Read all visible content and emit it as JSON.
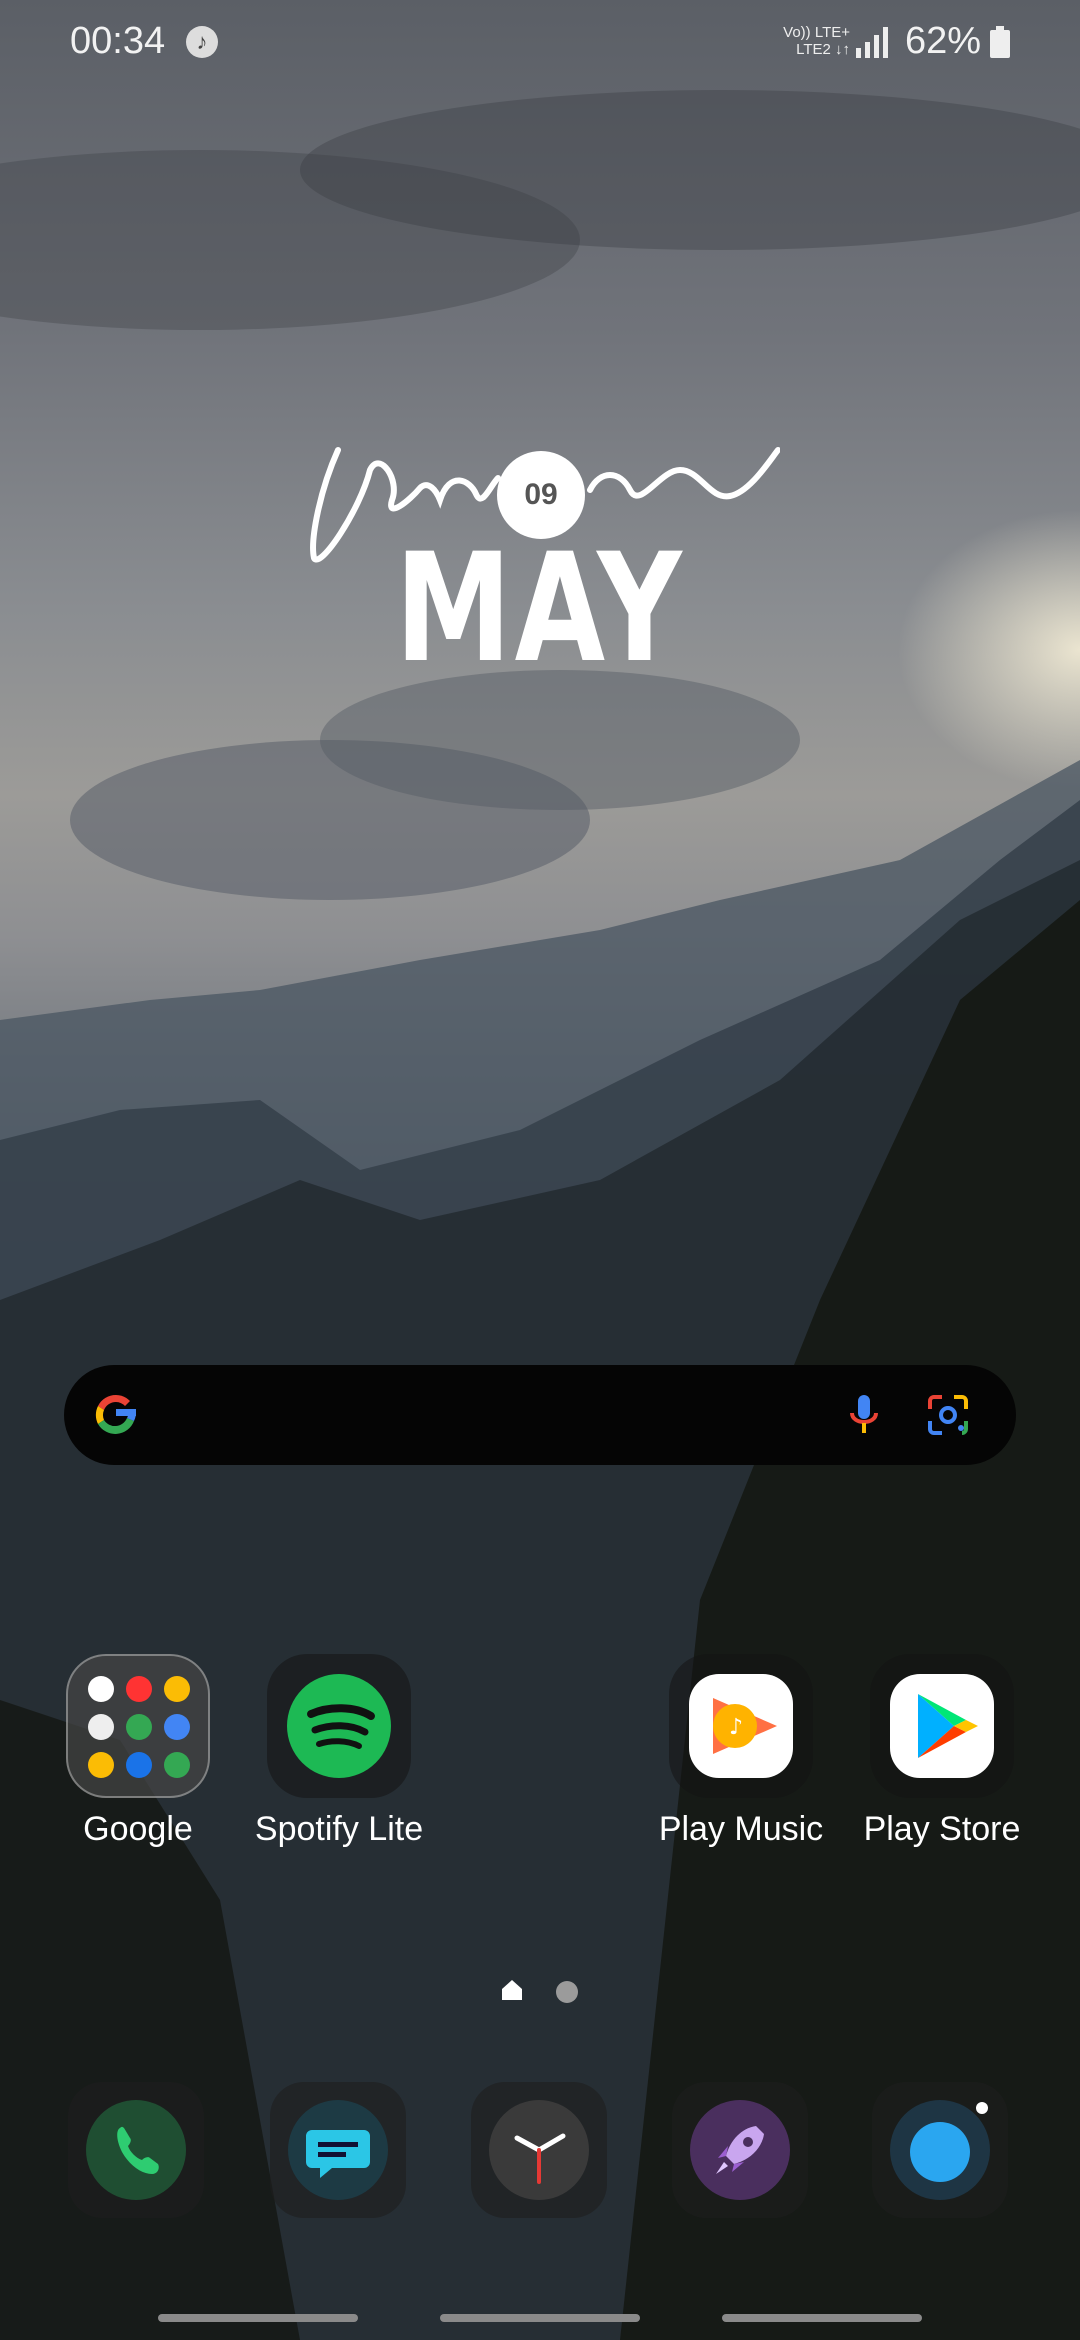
{
  "status_bar": {
    "time": "00:34",
    "network_line1": "Vo)) LTE+",
    "network_line2": "LTE2 ↓↑",
    "battery_percent": "62%"
  },
  "widget": {
    "day": "09",
    "month": "MAY"
  },
  "search_bar": {
    "logo_letter": "G"
  },
  "apps": [
    {
      "label": "Google",
      "icon": "google-folder-icon"
    },
    {
      "label": "Spotify Lite",
      "icon": "spotify-icon"
    },
    {
      "label": "Play Music",
      "icon": "play-music-icon"
    },
    {
      "label": "Play Store",
      "icon": "play-store-icon"
    }
  ],
  "dock": [
    {
      "icon": "phone-icon"
    },
    {
      "icon": "messages-icon"
    },
    {
      "icon": "clock-icon"
    },
    {
      "icon": "rocket-icon"
    },
    {
      "icon": "camera-icon"
    }
  ],
  "colors": {
    "spotify_green": "#1DB954",
    "phone_green": "#2e9a55",
    "messages_cyan": "#2bc6e6",
    "rocket_purple": "#9b5fd0",
    "camera_blue": "#2aa6f0"
  }
}
